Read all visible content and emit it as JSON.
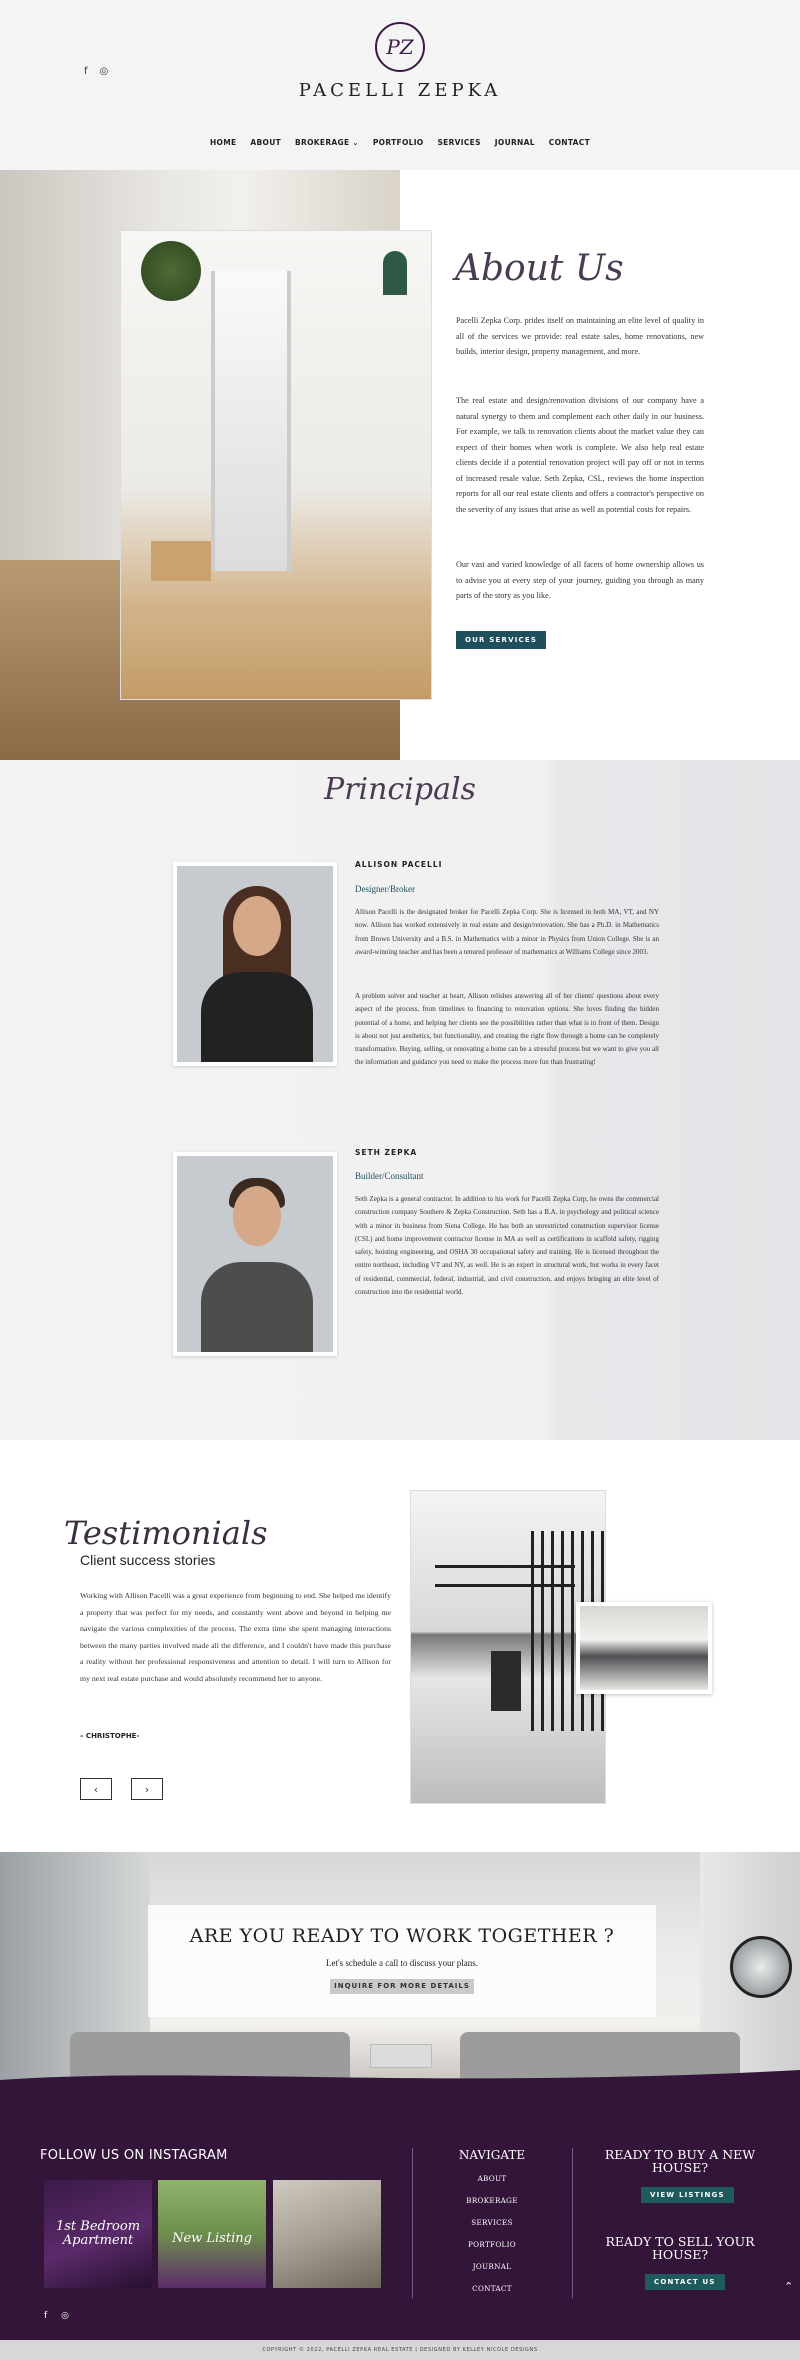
{
  "header": {
    "social": {
      "facebook": "f",
      "instagram": "◎"
    },
    "logo_monogram": "PZ",
    "brand": "PACELLI ZEPKA",
    "nav": [
      "HOME",
      "ABOUT",
      "BROKERAGE ⌄",
      "PORTFOLIO",
      "SERVICES",
      "JOURNAL",
      "CONTACT"
    ]
  },
  "about": {
    "title": "About Us",
    "p1": "Pacelli Zepka Corp. prides itself on maintaining an elite level of quality in all of the services we provide: real estate sales, home renovations, new builds, interior design, property management, and more.",
    "p2": "The real estate and design/renovation divisions of our company have a natural synergy to them and complement each other daily in our business. For example, we talk to renovation clients about the market value they can expect of their homes when work is complete. We also help real estate clients decide if a potential renovation project will pay off or not in terms of increased resale value. Seth Zepka, CSL, reviews the home inspection reports for all our real estate clients and offers a contractor's perspective on the severity of any issues that arise as well as potential costs for repairs.",
    "p3": "Our vast and varied knowledge of all facets of home ownership allows us to advise you at every step of your journey, guiding you through as many parts of the story as you like.",
    "button": "OUR SERVICES"
  },
  "principals": {
    "title": "Principals",
    "people": [
      {
        "name": "ALLISON PACELLI",
        "role": "Designer/Broker",
        "p1": "Allison Pacelli is the designated broker for Pacelli Zepka Corp. She is licensed in both MA, VT, and NY now. Allison has worked extensively in real estate and design/renovation. She has a Ph.D. in Mathematics from Brown University and a B.S. in Mathematics with a minor in Physics from Union College. She is an award-winning teacher and has been a tenured professor of mathematics at Williams College since 2003.",
        "p2": "A problem solver and teacher at heart, Allison relishes answering all of her clients' questions about every aspect of the process, from timelines to financing to renovation options. She loves finding the hidden potential of a home, and helping her clients see the possibilities rather than what is in front of them. Design is about not just aesthetics, but functionality, and creating the right flow through a home can be completely transformative. Buying, selling, or renovating a home can be a stressful process but we want to give you all the information and guidance you need to make the process more fun than frustrating!"
      },
      {
        "name": "SETH ZEPKA",
        "role": "Builder/Consultant",
        "p1": "Seth Zepka is a general contractor. In addition to his work for Pacelli Zepka Corp, he owns the commercial construction company Southere & Zepka Construction. Seth has a B.A. in psychology and political science with a minor in business from Siena College. He has both an unrestricted construction supervisor license (CSL) and home improvement contractor license in MA as well as certifications in scaffold safety, rigging safety, hoisting engineering, and OSHA 30 occupational safety and training. He is licensed throughout the entire northeast, including VT and NY, as well. He is an expert in structural work, but works in every facet of residential, commercial, federal, industrial, and civil construction, and enjoys bringing an elite level of construction into the residential world."
      }
    ]
  },
  "testimonials": {
    "title": "Testimonials",
    "subtitle": "Client success stories",
    "quote": "Working with Allison Pacelli was a great experience from beginning to end. She helped me identify a property that was perfect for my needs, and constantly went above and beyond in helping me navigate the various complexities of the process. The extra time she spent managing interactions between the many parties involved made all the difference, and I couldn't have made this purchase a reality without her professional responsiveness and attention to detail. I will turn to Allison for my next real estate purchase and would absolutely recommend her to anyone.",
    "author": "– CHRISTOPHE-",
    "prev": "‹",
    "next": "›"
  },
  "cta": {
    "title": "ARE YOU READY TO WORK TOGETHER ?",
    "subtitle": "Let's schedule a call to discuss your plans.",
    "button": "INQUIRE FOR MORE DETAILS"
  },
  "footer": {
    "instagram_title": "FOLLOW US ON INSTAGRAM",
    "ig_captions": [
      "1st Bedroom Apartment",
      "New Listing",
      ""
    ],
    "social": {
      "facebook": "f",
      "instagram": "◎"
    },
    "nav_title": "NAVIGATE",
    "nav": [
      "ABOUT",
      "BROKERAGE",
      "SERVICES",
      "PORTFOLIO",
      "JOURNAL",
      "CONTACT"
    ],
    "buy_title": "READY TO BUY A NEW HOUSE?",
    "buy_button": "VIEW LISTINGS",
    "sell_title": "READY TO SELL YOUR HOUSE?",
    "sell_button": "CONTACT US",
    "scroll_up": "⌃",
    "copyright": "COPYRIGHT © 2022, PACELLI ZEPKA REAL ESTATE | DESIGNED BY KELLEY NICOLE DESIGNS"
  },
  "colors": {
    "brand_purple": "#331539",
    "teal_button": "#1f4f5c",
    "accent_text": "#4a3b52"
  }
}
